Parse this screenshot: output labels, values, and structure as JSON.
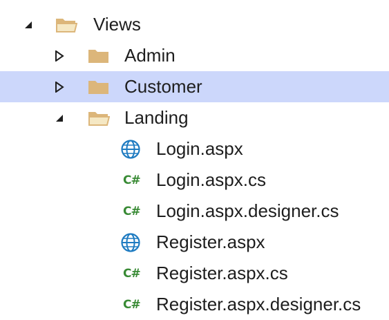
{
  "tree": {
    "items": [
      {
        "label": "Views",
        "kind": "folder-open",
        "expander": "expanded",
        "selected": false
      },
      {
        "label": "Admin",
        "kind": "folder",
        "expander": "collapsed",
        "selected": false
      },
      {
        "label": "Customer",
        "kind": "folder",
        "expander": "collapsed",
        "selected": true
      },
      {
        "label": "Landing",
        "kind": "folder-open",
        "expander": "expanded",
        "selected": false
      },
      {
        "label": "Login.aspx",
        "kind": "web-page-globe-icon",
        "selected": false
      },
      {
        "label": "Login.aspx.cs",
        "kind": "csharp-file-icon",
        "icon_text": "C#",
        "selected": false
      },
      {
        "label": "Login.aspx.designer.cs",
        "kind": "csharp-file-icon",
        "icon_text": "C#",
        "selected": false
      },
      {
        "label": "Register.aspx",
        "kind": "web-page-globe-icon",
        "selected": false
      },
      {
        "label": "Register.aspx.cs",
        "kind": "csharp-file-icon",
        "icon_text": "C#",
        "selected": false
      },
      {
        "label": "Register.aspx.designer.cs",
        "kind": "csharp-file-icon",
        "icon_text": "C#",
        "selected": false
      }
    ]
  },
  "colors": {
    "selection": "#ccd7fb",
    "folder": "#dcb67a",
    "folder_open_fill": "#f5e8c4",
    "globe": "#1e7bc1",
    "csharp": "#388a34",
    "expander": "#1e1e1e"
  }
}
